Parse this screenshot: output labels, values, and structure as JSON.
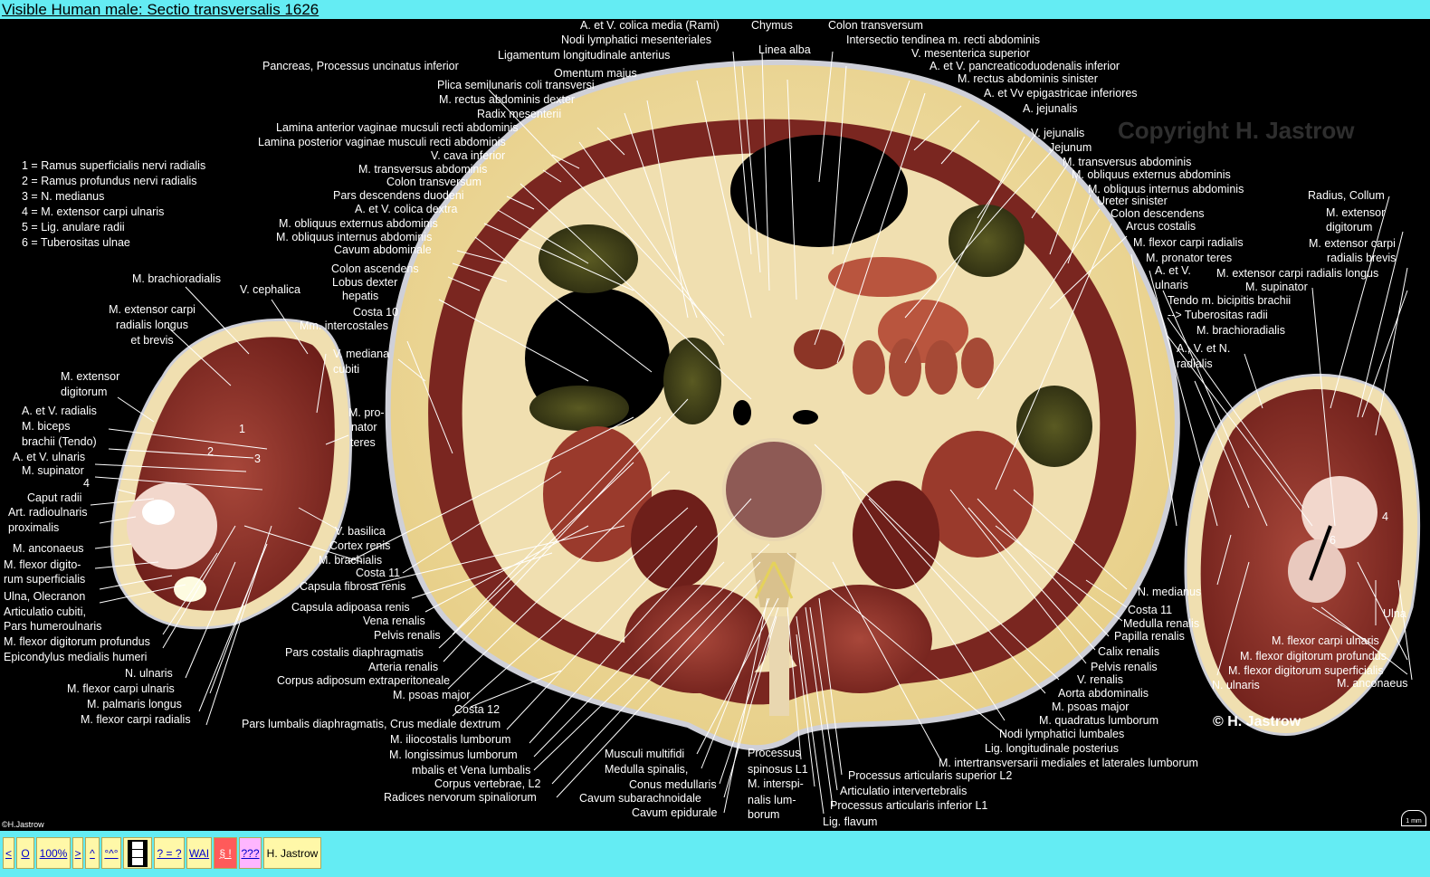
{
  "title": "Visible Human male: Sectio transversalis 1626",
  "watermark": "Copyright H. Jastrow",
  "copyright": "© H. Jastrow",
  "small_copyright": "©H.Jastrow",
  "scale_label": "1 mm",
  "legend": [
    "1 = Ramus superficialis nervi radialis",
    "2 = Ramus profundus nervi radialis",
    "3 = N. medianus",
    "4 = M. extensor carpi ulnaris",
    "5 = Lig. anulare radii",
    "6 = Tuberositas ulnae"
  ],
  "numbers_left": [
    "1",
    "2",
    "3",
    "4",
    "5"
  ],
  "numbers_right": [
    "4",
    "6"
  ],
  "labels_top": [
    "A. et V. colica media (Rami)",
    "Nodi lymphatici mesenteriales",
    "Chymus",
    "Colon transversum",
    "Linea alba",
    "Intersectio tendinea m. recti abdominis",
    "Ligamentum longitudinale anterius",
    "V. mesenterica superior",
    "Omentum majus",
    "A. et V. pancreaticoduodenalis inferior",
    "Pancreas, Processus uncinatus inferior",
    "M. rectus abdominis sinister",
    "Plica semilunaris coli transversi",
    "A. et Vv epigastricae inferiores",
    "M. rectus abdominis dexter",
    "A. jejunalis",
    "Radix mesenterii"
  ],
  "labels_left_center": [
    "Lamina anterior vaginae mucsuli recti abdominis",
    "Lamina posterior vaginae musculi recti abdominis",
    "V. cava inferior",
    "M. transversus abdominis",
    "Colon transversum",
    "Pars descendens duodeni",
    "A. et V. colica dextra",
    "M. obliquus externus abdominis",
    "M. obliquus internus abdominis",
    "Cavum abdominale",
    "Colon ascendens",
    "Lobus dexter",
    "hepatis",
    "Costa 10",
    "Mm. intercostales",
    "V. mediana",
    "cubiti",
    "M. pro-",
    "nator",
    "teres",
    "V. basilica",
    "Cortex renis",
    "M. brachialis",
    "Costa 11",
    "Capsula fibrosa renis",
    "Capsula adipoasa renis",
    "Vena renalis",
    "Pelvis renalis",
    "Pars costalis diaphragmatis",
    "Arteria renalis",
    "Corpus adiposum extraperitoneale",
    "M. psoas major",
    "Costa 12",
    "Pars lumbalis diaphragmatis, Crus mediale dextrum",
    "M. iliocostalis lumborum",
    "M. longissimus lumborum",
    "mbalis et Vena lumbalis",
    "Corpus vertebrae, L2",
    "Radices nervorum spinaliorum"
  ],
  "labels_bottom_center": [
    "Musculi multifidi",
    "Medulla spinalis,",
    "Conus medullaris",
    "Cavum subarachnoidale",
    "Cavum epidurale",
    "Processus",
    "spinosus L1",
    "M. interspi-",
    "nalis lum-",
    "borum",
    "Processus articularis superior L2",
    "Articulatio intervertebralis",
    "Processus articularis inferior L1",
    "Lig. flavum"
  ],
  "labels_right_center": [
    "V. jejunalis",
    "Jejunum",
    "M. transversus abdominis",
    "M. obliquus externus abdominis",
    "M. obliquus internus abdominis",
    "Ureter sinister",
    "Colon descendens",
    "Arcus costalis",
    "M. flexor carpi radialis",
    "M. pronator teres",
    "A. et V.",
    "ulnaris",
    "Tendo m. bicipitis brachii",
    "--> Tuberositas radii",
    "M. brachioradialis",
    "A., V. et N.",
    "radialis",
    "N. medianus",
    "Costa 11",
    "Medulla renalis",
    "Papilla renalis",
    "Calix renalis",
    "Pelvis renalis",
    "V. renalis",
    "Aorta abdominalis",
    "M. psoas major",
    "M. quadratus lumborum",
    "Nodi lymphatici lumbales",
    "Lig. longitudinale posterius",
    "M. intertransversarii mediales et laterales lumborum"
  ],
  "labels_left_arm": [
    "M. brachioradialis",
    "V. cephalica",
    "M. extensor carpi",
    "radialis longus",
    "et brevis",
    "M. extensor",
    "digitorum",
    "A. et V. radialis",
    "M. biceps",
    "brachii (Tendo)",
    "A. et V. ulnaris",
    "M. supinator",
    "Caput radii",
    "Art. radioulnaris",
    "proximalis",
    "M. anconaeus",
    "M. flexor digito-",
    "rum superficialis",
    "Ulna, Olecranon",
    "Articulatio cubiti,",
    "Pars humeroulnaris",
    "M. flexor digitorum profundus",
    "Epicondylus medialis humeri",
    "N. ulnaris",
    "M. flexor carpi ulnaris",
    "M. palmaris longus",
    "M. flexor carpi radialis"
  ],
  "labels_right_arm": [
    "Radius, Collum",
    "M. extensor",
    "digitorum",
    "M. extensor carpi",
    "radialis brevis",
    "M. extensor carpi radialis longus",
    "M. supinator",
    "Ulna",
    "M. flexor carpi ulnaris",
    "M. flexor digitorum profundus",
    "M. flexor digitorum superficialis",
    "N. ulnaris",
    "M. anconaeus"
  ],
  "nav": {
    "prev": "<",
    "home": "O",
    "zoom": "100%",
    "next": ">",
    "up": "^",
    "tilt": "°^°",
    "help": "? = ?",
    "wai": "WAI",
    "legal": "§ !",
    "faq": "???",
    "author": "H. Jastrow"
  }
}
